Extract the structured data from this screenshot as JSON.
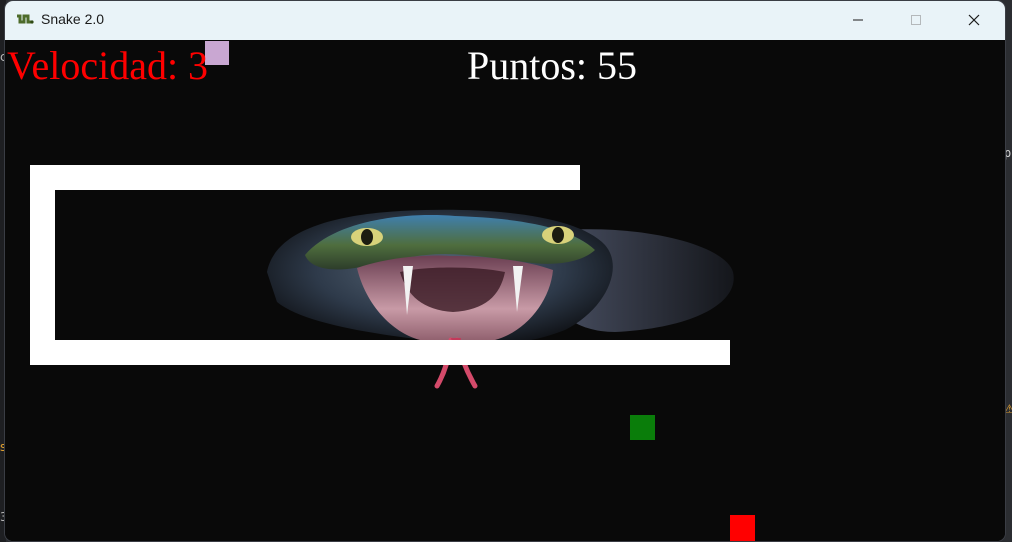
{
  "window": {
    "title": "Snake 2.0",
    "icon": "snake-app-icon",
    "controls": [
      "minimize-icon",
      "maximize-icon",
      "close-icon"
    ]
  },
  "hud": {
    "speed_text": "Velocidad: 3",
    "score_text": "Puntos: 55"
  },
  "background": {
    "right_text": "py",
    "right_warning": "⚠",
    "left_a": "c",
    "left_b": "s",
    "left_c": "3"
  },
  "colors": {
    "speed": "#ff0000",
    "score": "#ffffff",
    "snake_body": "#ffffff",
    "food": "#0a7d0a",
    "bonus": "#ff0000",
    "canvas": "#090909",
    "titlebar": "#e9f3f8"
  }
}
